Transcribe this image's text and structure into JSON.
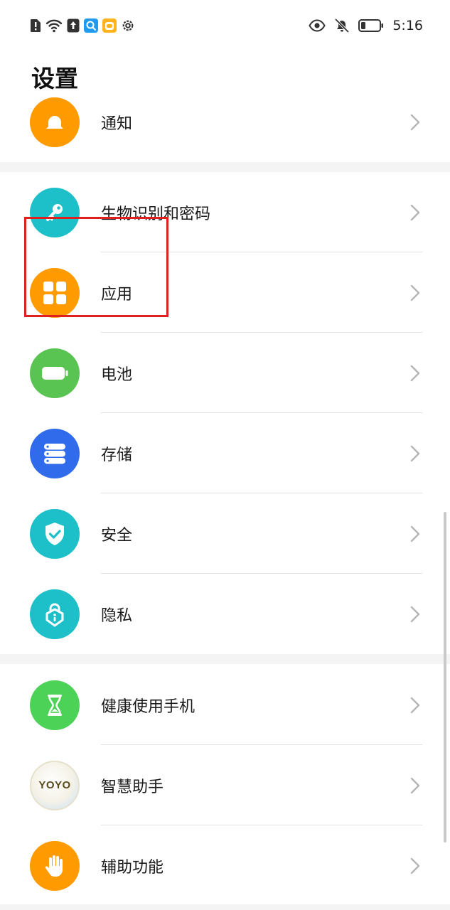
{
  "status_bar": {
    "time": "5:16",
    "left_icons": [
      "alert-sim-icon",
      "wifi-icon",
      "upload-icon",
      "search-app-icon",
      "app-notification-icon",
      "gear-icon"
    ],
    "right_icons": [
      "eye-icon",
      "bell-off-icon",
      "battery-icon"
    ]
  },
  "page": {
    "title": "设置"
  },
  "rows": {
    "notifications": {
      "label": "通知",
      "icon": "bell-icon",
      "color": "#FF9A00"
    },
    "biometrics": {
      "label": "生物识别和密码",
      "icon": "key-icon",
      "color": "#1DC0C8"
    },
    "apps": {
      "label": "应用",
      "icon": "grid-icon",
      "color": "#FF9A00"
    },
    "battery": {
      "label": "电池",
      "icon": "battery-icon",
      "color": "#5AC452"
    },
    "storage": {
      "label": "存储",
      "icon": "storage-icon",
      "color": "#2F6BEA"
    },
    "security": {
      "label": "安全",
      "icon": "shield-check-icon",
      "color": "#1DC0C8"
    },
    "privacy": {
      "label": "隐私",
      "icon": "privacy-lock-icon",
      "color": "#1DC0C8"
    },
    "digital_balance": {
      "label": "健康使用手机",
      "icon": "hourglass-icon",
      "color": "#4CD256"
    },
    "assistant": {
      "label": "智慧助手",
      "icon": "yoyo-icon",
      "badge": "YOYO"
    },
    "accessibility": {
      "label": "辅助功能",
      "icon": "hand-icon",
      "color": "#FF9A00"
    }
  },
  "colors": {
    "highlight": "#E0201E",
    "chevron": "#B5B5B5",
    "divider": "#E3E3E3"
  }
}
